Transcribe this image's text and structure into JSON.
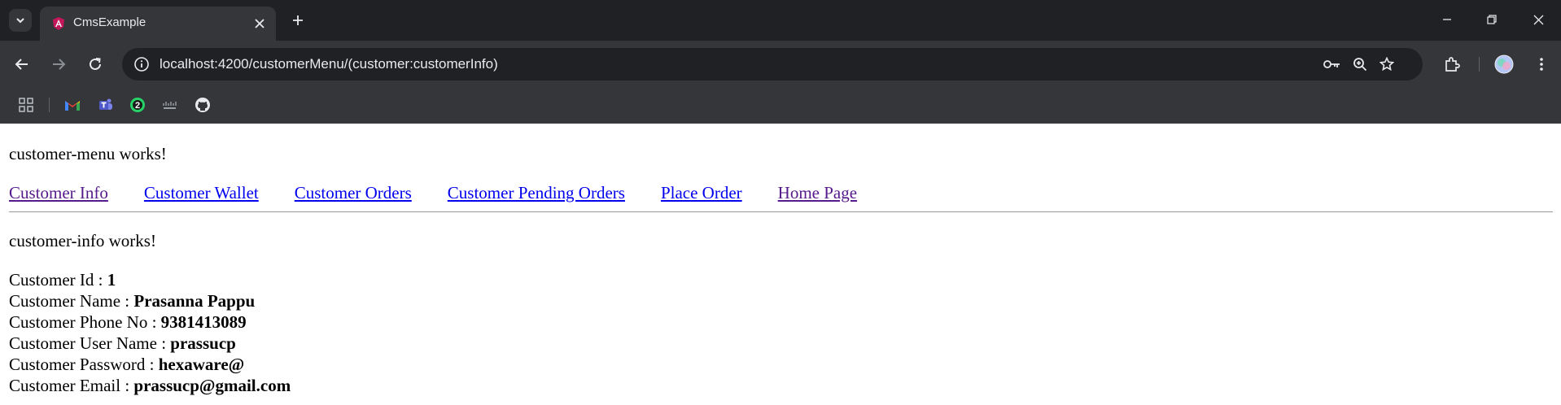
{
  "browser": {
    "tab_title": "CmsExample",
    "url": "localhost:4200/customerMenu/(customer:customerInfo)",
    "bookmarks": [
      "apps-icon",
      "gmail-icon",
      "teams-icon",
      "whatsapp-icon",
      "cisco-icon",
      "github-icon"
    ],
    "whatsapp_badge": "2",
    "accent_color": "#35363a"
  },
  "page": {
    "menu_heading": "customer-menu works!",
    "menu_links": [
      {
        "label": "Customer Info",
        "visited": true
      },
      {
        "label": "Customer Wallet",
        "visited": false
      },
      {
        "label": "Customer Orders",
        "visited": false
      },
      {
        "label": "Customer Pending Orders",
        "visited": false
      },
      {
        "label": "Place Order",
        "visited": false
      },
      {
        "label": "Home Page",
        "visited": true
      }
    ],
    "info_heading": "customer-info works!",
    "details": [
      {
        "label": "Customer Id : ",
        "value": "1"
      },
      {
        "label": "Customer Name : ",
        "value": "Prasanna Pappu"
      },
      {
        "label": "Customer Phone No : ",
        "value": "9381413089"
      },
      {
        "label": "Customer User Name : ",
        "value": "prassucp"
      },
      {
        "label": "Customer Password : ",
        "value": "hexaware@"
      },
      {
        "label": "Customer Email : ",
        "value": "prassucp@gmail.com"
      }
    ]
  }
}
